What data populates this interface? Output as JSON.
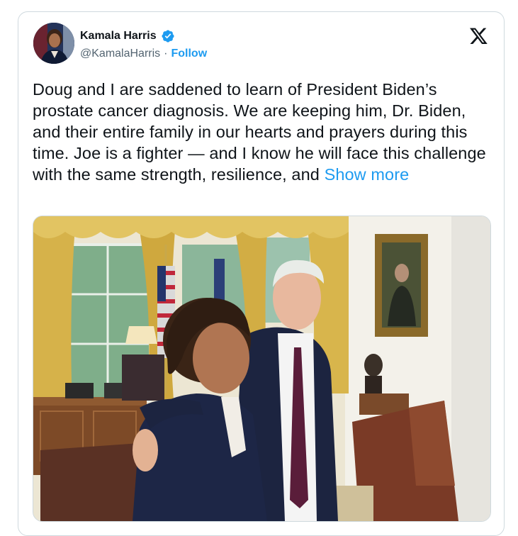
{
  "tweet": {
    "author_name": "Kamala Harris",
    "handle": "@KamalaHarris",
    "separator": "·",
    "follow_label": "Follow",
    "text": "Doug and I are saddened to learn of President Biden’s prostate cancer diagnosis. We are keeping him, Dr. Biden, and their entire family in our hearts and prayers during this time. Joe is a fighter — and I know he will face this challenge with the same strength, resilience, and",
    "show_more_label": "Show more"
  },
  "icons": {
    "verified": "verified-badge-icon",
    "platform_logo": "x-logo-icon"
  },
  "colors": {
    "accent": "#1d9bf0",
    "text": "#0f1419",
    "muted": "#536471",
    "border": "#cfd9de"
  }
}
